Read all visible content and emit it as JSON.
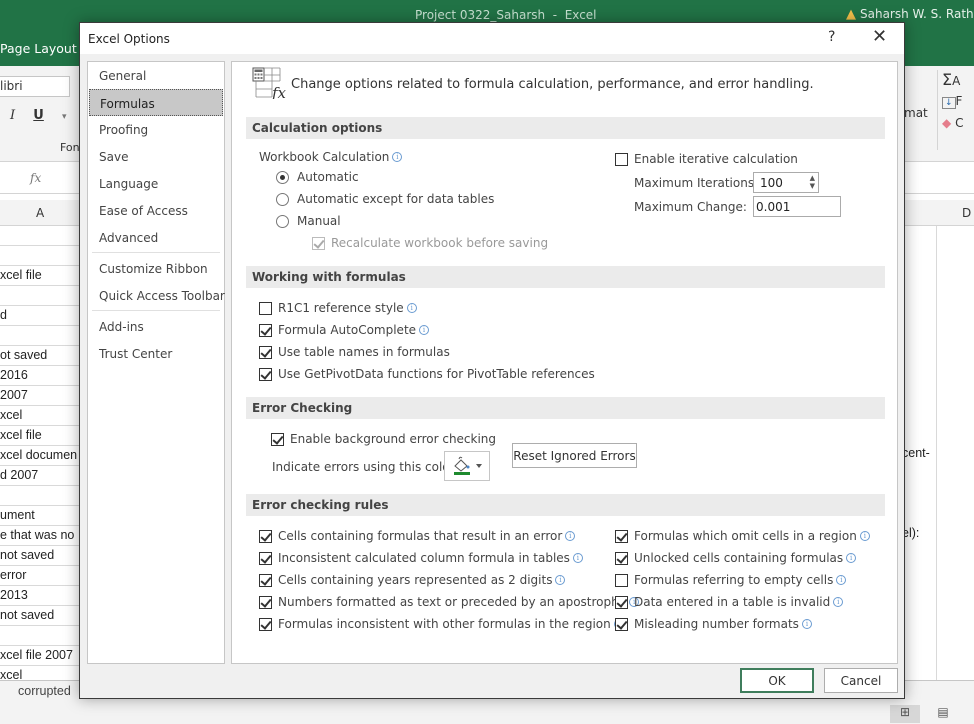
{
  "excel": {
    "window_title": "Project 0322_Saharsh  -  Excel",
    "user_name": "Saharsh W. S. Rathor",
    "ribbon_tab": "Page Layout",
    "font_name": "libri",
    "format_buttons": [
      "I",
      "U",
      "▾"
    ],
    "font_group_label": "Fon",
    "format_label": "mat",
    "ribbon_right_items": [
      "A",
      "F",
      "C"
    ],
    "fx_label": "fx",
    "column_a": "A",
    "column_d": "D",
    "cells": [
      "",
      "",
      "xcel file",
      "",
      "d",
      "",
      "ot saved",
      " 2016",
      " 2007",
      "xcel",
      "xcel file",
      "xcel documen",
      "d 2007",
      "",
      "ument",
      "e that was no",
      "not saved",
      " error",
      " 2013",
      " not saved",
      "",
      "xcel file 2007",
      "xcel"
    ],
    "right_cell_texts": [
      "cent-",
      "el):"
    ],
    "sheet_tab": "corrupted"
  },
  "dialog": {
    "title": "Excel Options",
    "help_label": "?",
    "close_label": "✕",
    "nav": [
      {
        "label": "General",
        "selected": false
      },
      {
        "label": "Formulas",
        "selected": true
      },
      {
        "label": "Proofing",
        "selected": false
      },
      {
        "label": "Save",
        "selected": false
      },
      {
        "label": "Language",
        "selected": false
      },
      {
        "label": "Ease of Access",
        "selected": false
      },
      {
        "label": "Advanced",
        "selected": false
      },
      {
        "label": "Customize Ribbon",
        "selected": false
      },
      {
        "label": "Quick Access Toolbar",
        "selected": false
      },
      {
        "label": "Add-ins",
        "selected": false
      },
      {
        "label": "Trust Center",
        "selected": false
      }
    ],
    "header_text": "Change options related to formula calculation, performance, and error handling.",
    "sections": {
      "calculation": "Calculation options",
      "working": "Working with formulas",
      "error_checking": "Error Checking",
      "error_rules": "Error checking rules"
    },
    "calculation": {
      "workbook_label": "Workbook Calculation",
      "radios": [
        {
          "label": "Automatic",
          "checked": true
        },
        {
          "label": "Automatic except for data tables",
          "checked": false
        },
        {
          "label": "Manual",
          "checked": false
        }
      ],
      "recalc_label": "Recalculate workbook before saving",
      "recalc_checked": true,
      "iterative_label": "Enable iterative calculation",
      "iterative_checked": false,
      "max_iterations_label": "Maximum Iterations:",
      "max_iterations_value": "100",
      "max_change_label": "Maximum Change:",
      "max_change_value": "0.001"
    },
    "working": [
      {
        "label": "R1C1 reference style",
        "checked": false,
        "info": true
      },
      {
        "label": "Formula AutoComplete",
        "checked": true,
        "info": true
      },
      {
        "label": "Use table names in formulas",
        "checked": true,
        "info": false
      },
      {
        "label": "Use GetPivotData functions for PivotTable references",
        "checked": true,
        "info": false
      }
    ],
    "error_checking": {
      "enable_label": "Enable background error checking",
      "enable_checked": true,
      "color_label": "Indicate errors using this color:",
      "error_color": "#1e8a2e",
      "reset_button": "Reset Ignored Errors"
    },
    "rules_left": [
      {
        "label": "Cells containing formulas that result in an error",
        "checked": true
      },
      {
        "label": "Inconsistent calculated column formula in tables",
        "checked": true
      },
      {
        "label": "Cells containing years represented as 2 digits",
        "checked": true
      },
      {
        "label": "Numbers formatted as text or preceded by an apostrophe",
        "checked": true
      },
      {
        "label": "Formulas inconsistent with other formulas in the region",
        "checked": true
      }
    ],
    "rules_right": [
      {
        "label": "Formulas which omit cells in a region",
        "checked": true
      },
      {
        "label": "Unlocked cells containing formulas",
        "checked": true
      },
      {
        "label": "Formulas referring to empty cells",
        "checked": false
      },
      {
        "label": "Data entered in a table is invalid",
        "checked": true
      },
      {
        "label": "Misleading number formats",
        "checked": true
      }
    ],
    "ok_button": "OK",
    "cancel_button": "Cancel"
  }
}
